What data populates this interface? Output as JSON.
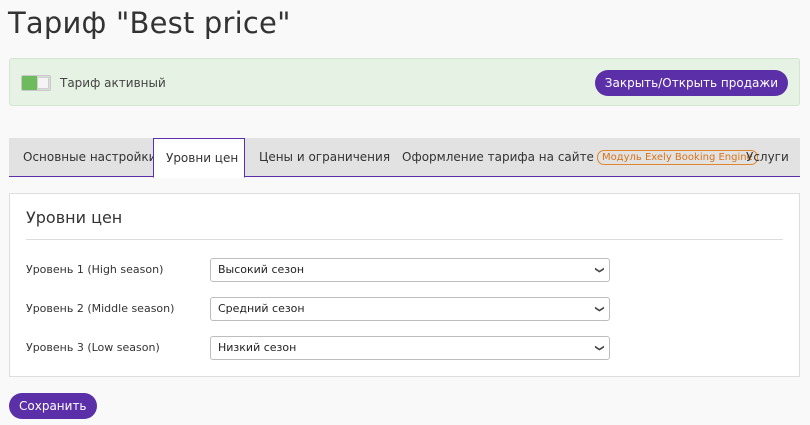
{
  "page": {
    "title": "Тариф \"Best price\""
  },
  "status": {
    "active_label": "Тариф активный",
    "toggle_on": true,
    "toggle_sales_label": "Закрыть/Открыть продажи"
  },
  "tabs": [
    {
      "label": "Основные настройки",
      "active": false
    },
    {
      "label": "Уровни цен",
      "active": true
    },
    {
      "label": "Цены и ограничения",
      "active": false
    },
    {
      "label": "Оформление тарифа на сайте",
      "badge": "Модуль Exely Booking Engine",
      "active": false
    },
    {
      "label": "Услуги",
      "active": false
    }
  ],
  "price_levels": {
    "title": "Уровни цен",
    "rows": [
      {
        "label": "Уровень 1 (High season)",
        "value": "Высокий сезон"
      },
      {
        "label": "Уровень 2 (Middle season)",
        "value": "Средний сезон"
      },
      {
        "label": "Уровень 3 (Low season)",
        "value": "Низкий сезон"
      }
    ]
  },
  "footer": {
    "save_label": "Сохранить"
  },
  "colors": {
    "accent": "#5a2fa8",
    "active_panel": "#e6f2e3",
    "toggle_on": "#6dbb5c",
    "badge": "#e0862e"
  },
  "icons": {
    "select_arrow": "chevron-down-icon"
  }
}
